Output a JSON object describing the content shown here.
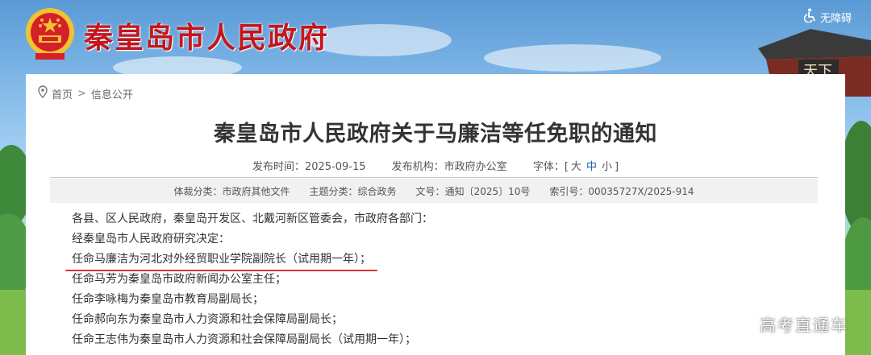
{
  "header": {
    "site_title": "秦皇岛市人民政府",
    "accessibility_label": "无障碍"
  },
  "breadcrumb": {
    "home": "首页",
    "separator": ">",
    "current": "信息公开"
  },
  "article": {
    "title": "秦皇岛市人民政府关于马廉洁等任免职的通知",
    "publish_date_label": "发布时间：",
    "publish_date": "2025-09-15",
    "publisher_label": "发布机构：",
    "publisher": "市政府办公室",
    "font_size_label": "字体：",
    "font_size_open": "[",
    "font_sizes": [
      "大",
      "中",
      "小"
    ],
    "font_size_close": "]",
    "selected_font_size": "中"
  },
  "info_bar": {
    "genre_label": "体裁分类：",
    "genre": "市政府其他文件",
    "topic_label": "主题分类：",
    "topic": "综合政务",
    "doc_no_label": "文号：",
    "doc_no": "通知〔2025〕10号",
    "index_label": "索引号：",
    "index_no": "00035727X/2025-914"
  },
  "content": {
    "lines": [
      "各县、区人民政府，秦皇岛开发区、北戴河新区管委会，市政府各部门：",
      "经秦皇岛市人民政府研究决定：",
      "任命马廉洁为河北对外经贸职业学院副院长（试用期一年）；",
      "任命马芳为秦皇岛市政府新闻办公室主任；",
      "任命李咏梅为秦皇岛市教育局副局长；",
      "任命郝向东为秦皇岛市人力资源和社会保障局副局长；",
      "任命王志伟为秦皇岛市人力资源和社会保障局副局长（试用期一年）；"
    ],
    "highlighted_line_index": 2
  },
  "watermark": "高考直通车",
  "colors": {
    "title_red": "#c4161c",
    "underline_red": "#e0303a",
    "link_blue": "#1a5fb4"
  },
  "icons": [
    "national-emblem-icon",
    "accessibility-icon",
    "location-pin-icon"
  ]
}
